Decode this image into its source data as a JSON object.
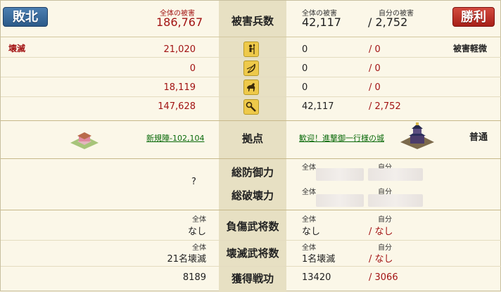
{
  "badges": {
    "left": "敗北",
    "right": "勝利"
  },
  "header": {
    "left_label": "全体の被害",
    "left_value": "186,767",
    "center": "被害兵数",
    "right_total_label": "全体の被害",
    "right_total_value": "42,117",
    "right_self_label": "自分の被害",
    "right_self_value": "/ 2,752"
  },
  "status": {
    "left": "壊滅",
    "right": "被害軽微"
  },
  "unit_rows": [
    {
      "icon": "spearman-icon",
      "left": "21,020",
      "right_total": "0",
      "right_self": "/ 0"
    },
    {
      "icon": "archer-icon",
      "left": "0",
      "right_total": "0",
      "right_self": "/ 0"
    },
    {
      "icon": "cavalry-icon",
      "left": "18,119",
      "right_total": "0",
      "right_self": "/ 0"
    },
    {
      "icon": "siege-icon",
      "left": "147,628",
      "right_total": "42,117",
      "right_self": "/ 2,752"
    }
  ],
  "base": {
    "center": "拠点",
    "left_link": "新規陣-102,104",
    "right_link": "歓迎！進撃御一行様の城",
    "right_label": "普通"
  },
  "defense": {
    "center": "総防御力",
    "total_label": "全体",
    "self_label": "自分"
  },
  "destroy": {
    "center": "総破壊力",
    "total_label": "全体",
    "self_label": "自分"
  },
  "left_unknown": "?",
  "injured": {
    "center": "負傷武将数",
    "left_label": "全体",
    "left_value": "なし",
    "right_total_label": "全体",
    "right_total_value": "なし",
    "right_self_label": "自分",
    "right_self_value": "/ なし"
  },
  "destroyed": {
    "center": "壊滅武将数",
    "left_label": "全体",
    "left_value": "21名壊滅",
    "right_total_label": "全体",
    "right_total_value": "1名壊滅",
    "right_self_label": "自分",
    "right_self_value": "/ なし"
  },
  "merit": {
    "center": "獲得戦功",
    "left": "8189",
    "right_total": "13420",
    "right_self": "/ 3066"
  },
  "colors": {
    "defeat": "#2b5a89",
    "victory": "#a71f18",
    "loss_red": "#a21313",
    "link": "#0a6a0a"
  }
}
